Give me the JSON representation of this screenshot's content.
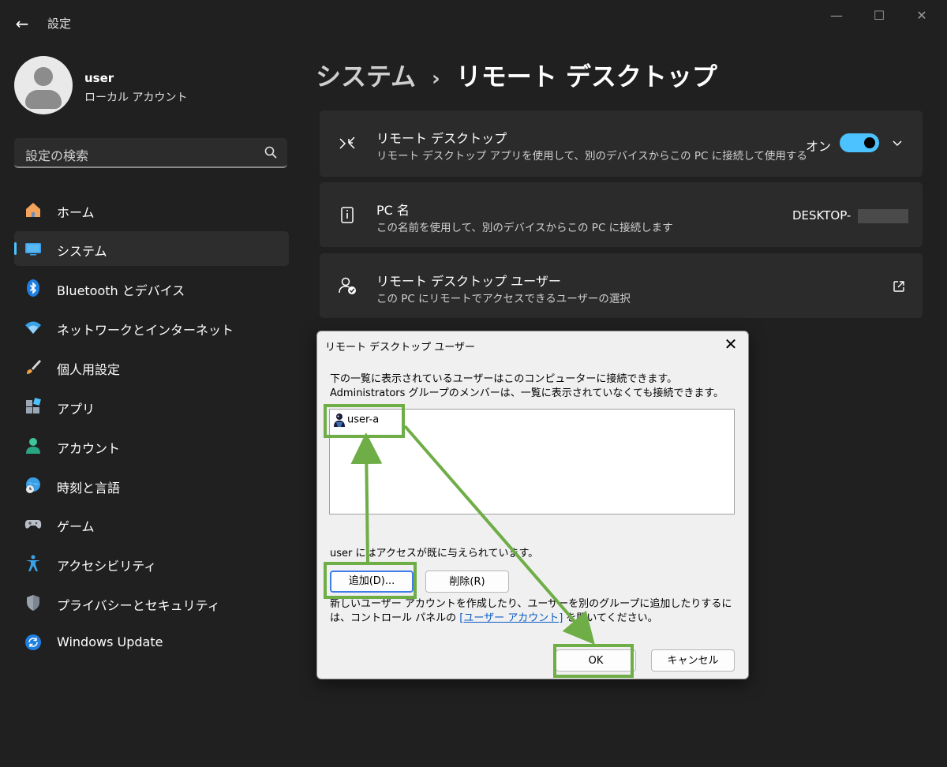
{
  "window": {
    "title": "設定",
    "controls": [
      "—",
      "☐",
      "✕"
    ]
  },
  "profile": {
    "name": "user",
    "account_type": "ローカル アカウント"
  },
  "search": {
    "placeholder": "設定の検索"
  },
  "nav": {
    "items": [
      {
        "label": "ホーム",
        "icon": "home-icon",
        "active": false
      },
      {
        "label": "システム",
        "icon": "system-icon",
        "active": true
      },
      {
        "label": "Bluetooth とデバイス",
        "icon": "bluetooth-icon",
        "active": false
      },
      {
        "label": "ネットワークとインターネット",
        "icon": "wifi-icon",
        "active": false
      },
      {
        "label": "個人用設定",
        "icon": "brush-icon",
        "active": false
      },
      {
        "label": "アプリ",
        "icon": "apps-icon",
        "active": false
      },
      {
        "label": "アカウント",
        "icon": "account-icon",
        "active": false
      },
      {
        "label": "時刻と言語",
        "icon": "globe-clock-icon",
        "active": false
      },
      {
        "label": "ゲーム",
        "icon": "gamepad-icon",
        "active": false
      },
      {
        "label": "アクセシビリティ",
        "icon": "accessibility-icon",
        "active": false
      },
      {
        "label": "プライバシーとセキュリティ",
        "icon": "shield-icon",
        "active": false
      },
      {
        "label": "Windows Update",
        "icon": "update-icon",
        "active": false
      }
    ]
  },
  "header": {
    "parent": "システム",
    "separator": "›",
    "current": "リモート デスクトップ"
  },
  "cards": {
    "remote_desktop": {
      "title": "リモート デスクトップ",
      "description": "リモート デスクトップ アプリを使用して、別のデバイスからこの PC に接続して使用する",
      "toggle_label": "オン",
      "toggle_on": true
    },
    "pc_name": {
      "title": "PC 名",
      "description": "この名前を使用して、別のデバイスからこの PC に接続します",
      "value": "DESKTOP-"
    },
    "remote_users": {
      "title": "リモート デスクトップ ユーザー",
      "description": "この PC にリモートでアクセスできるユーザーの選択"
    }
  },
  "dialog": {
    "title": "リモート デスクトップ ユーザー",
    "description": "下の一覧に表示されているユーザーはこのコンピューターに接続できます。Administrators グループのメンバーは、一覧に表示されていなくても接続できます。",
    "users": [
      "user-a"
    ],
    "access_note": "user にはアクセスが既に与えられています。",
    "add_button": "追加(D)...",
    "remove_button": "削除(R)",
    "footer_text_before": "新しいユーザー アカウントを作成したり、ユーザーを別のグループに追加したりするには、コントロール パネルの ",
    "footer_link": "[ユーザー アカウント]",
    "footer_text_after": " を開いてください。",
    "ok_button": "OK",
    "cancel_button": "キャンセル"
  },
  "colors": {
    "accent": "#4cc2ff",
    "annotation": "#6fad47",
    "background": "#202020",
    "card": "#2b2b2b"
  }
}
